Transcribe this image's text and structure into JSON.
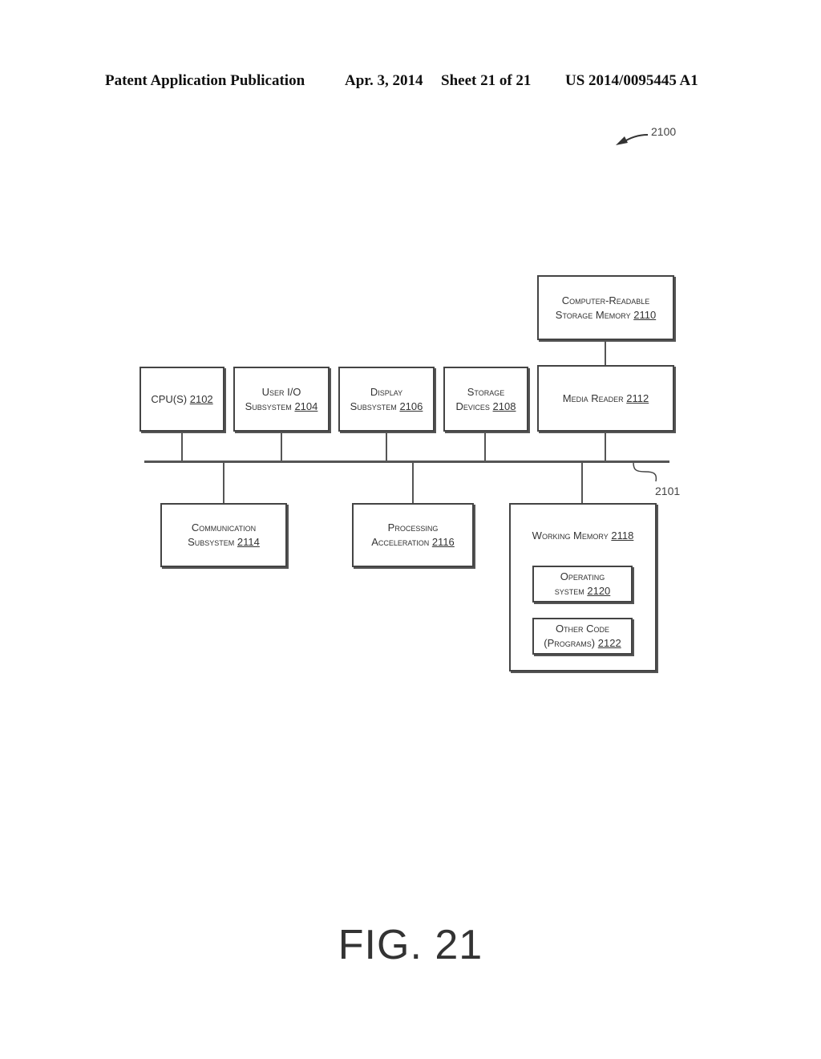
{
  "header": {
    "publication": "Patent Application Publication",
    "date": "Apr. 3, 2014",
    "sheet": "Sheet 21 of 21",
    "patent_number": "US 2014/0095445 A1"
  },
  "figure": {
    "ref_number": "2100",
    "bus_ref": "2101",
    "caption": "FIG. 21"
  },
  "boxes": {
    "storage_memory": {
      "line1": "Computer-Readable",
      "line2": "Storage Memory",
      "num": "2110"
    },
    "cpu": {
      "line1": "CPU(S)",
      "num": "2102"
    },
    "user_io": {
      "line1": "User I/O",
      "line2": "Subsystem",
      "num": "2104"
    },
    "display": {
      "line1": "Display",
      "line2": "Subsystem",
      "num": "2106"
    },
    "storage_devices": {
      "line1": "Storage",
      "line2": "Devices",
      "num": "2108"
    },
    "media_reader": {
      "line1": "Media Reader",
      "num": "2112"
    },
    "communication": {
      "line1": "Communication",
      "line2": "Subsystem",
      "num": "2114"
    },
    "processing": {
      "line1": "Processing",
      "line2": "Acceleration",
      "num": "2116"
    },
    "working_memory": {
      "line1": "Working Memory",
      "num": "2118"
    },
    "operating_system": {
      "line1": "Operating",
      "line2": "system",
      "num": "2120"
    },
    "other_code": {
      "line1": "Other Code",
      "line2": "(Programs)",
      "num": "2122"
    }
  }
}
